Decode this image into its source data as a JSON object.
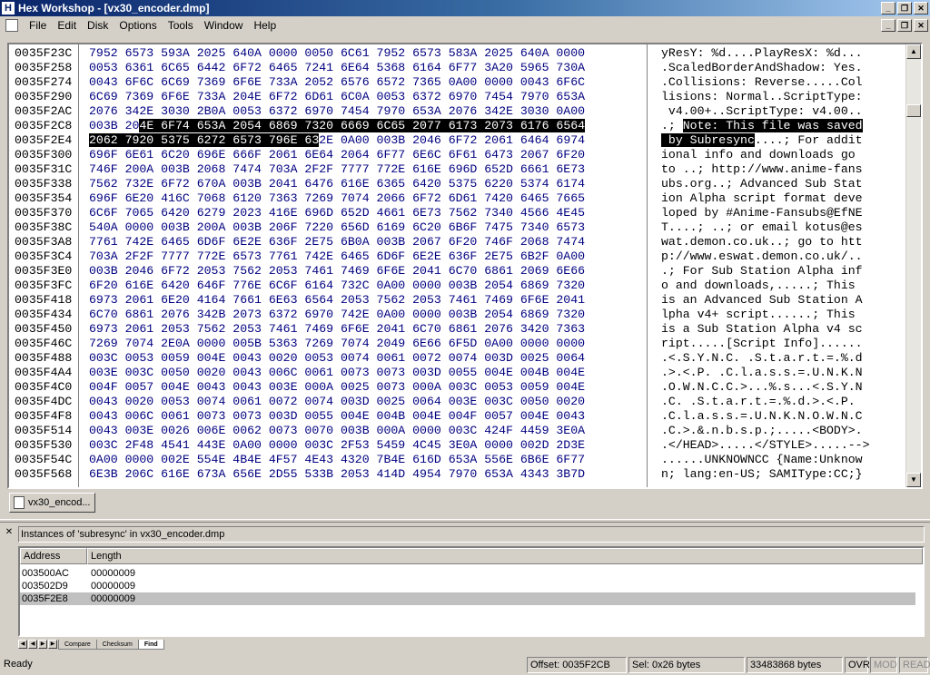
{
  "window": {
    "app_icon_glyph": "H",
    "title": "Hex Workshop - [vx30_encoder.dmp]",
    "buttons": [
      "_",
      "❐",
      "✕"
    ]
  },
  "menu": {
    "items": [
      "File",
      "Edit",
      "Disk",
      "Options",
      "Tools",
      "Window",
      "Help"
    ],
    "mdi_buttons": [
      "_",
      "❐",
      "✕"
    ]
  },
  "hex_rows": [
    {
      "addr": "0035F23C",
      "hex": "7952 6573 593A 2025 640A 0000 0050 6C61 7952 6573 583A 2025 640A 0000",
      "ascii": "yResY: %d....PlayResX: %d..."
    },
    {
      "addr": "0035F258",
      "hex": "0053 6361 6C65 6442 6F72 6465 7241 6E64 5368 6164 6F77 3A20 5965 730A",
      "ascii": ".ScaledBorderAndShadow: Yes."
    },
    {
      "addr": "0035F274",
      "hex": "0043 6F6C 6C69 7369 6F6E 733A 2052 6576 6572 7365 0A00 0000 0043 6F6C",
      "ascii": ".Collisions: Reverse.....Col"
    },
    {
      "addr": "0035F290",
      "hex": "6C69 7369 6F6E 733A 204E 6F72 6D61 6C0A 0053 6372 6970 7454 7970 653A",
      "ascii": "lisions: Normal..ScriptType:"
    },
    {
      "addr": "0035F2AC",
      "hex": "2076 342E 3030 2B0A 0053 6372 6970 7454 7970 653A 2076 342E 3030 0A00",
      "ascii": " v4.00+..ScriptType: v4.00.."
    },
    {
      "addr": "0035F2C8",
      "hex_pre": "003B 20",
      "hex_sel": "4E 6F74 653A 2054 6869 7320 6669 6C65 2077 6173 2073 6176 6564",
      "hex_post": "",
      "ascii_pre": ".; ",
      "ascii_sel": "Note: This file was saved",
      "ascii_post": ""
    },
    {
      "addr": "0035F2E4",
      "hex_pre": "",
      "hex_sel": "2062 7920 5375 6272 6573 796E 63",
      "hex_post": "2E 0A00 003B 2046 6F72 2061 6464 6974",
      "ascii_pre": "",
      "ascii_sel": " by Subresync",
      "ascii_post": "....; For addit"
    },
    {
      "addr": "0035F300",
      "hex": "696F 6E61 6C20 696E 666F 2061 6E64 2064 6F77 6E6C 6F61 6473 2067 6F20",
      "ascii": "ional info and downloads go "
    },
    {
      "addr": "0035F31C",
      "hex": "746F 200A 003B 2068 7474 703A 2F2F 7777 772E 616E 696D 652D 6661 6E73",
      "ascii": "to ..; http://www.anime-fans"
    },
    {
      "addr": "0035F338",
      "hex": "7562 732E 6F72 670A 003B 2041 6476 616E 6365 6420 5375 6220 5374 6174",
      "ascii": "ubs.org..; Advanced Sub Stat"
    },
    {
      "addr": "0035F354",
      "hex": "696F 6E20 416C 7068 6120 7363 7269 7074 2066 6F72 6D61 7420 6465 7665",
      "ascii": "ion Alpha script format deve"
    },
    {
      "addr": "0035F370",
      "hex": "6C6F 7065 6420 6279 2023 416E 696D 652D 4661 6E73 7562 7340 4566 4E45",
      "ascii": "loped by #Anime-Fansubs@EfNE"
    },
    {
      "addr": "0035F38C",
      "hex": "540A 0000 003B 200A 003B 206F 7220 656D 6169 6C20 6B6F 7475 7340 6573",
      "ascii": "T....; ..; or email kotus@es"
    },
    {
      "addr": "0035F3A8",
      "hex": "7761 742E 6465 6D6F 6E2E 636F 2E75 6B0A 003B 2067 6F20 746F 2068 7474",
      "ascii": "wat.demon.co.uk..; go to htt"
    },
    {
      "addr": "0035F3C4",
      "hex": "703A 2F2F 7777 772E 6573 7761 742E 6465 6D6F 6E2E 636F 2E75 6B2F 0A00",
      "ascii": "p://www.eswat.demon.co.uk/.."
    },
    {
      "addr": "0035F3E0",
      "hex": "003B 2046 6F72 2053 7562 2053 7461 7469 6F6E 2041 6C70 6861 2069 6E66",
      "ascii": ".; For Sub Station Alpha inf"
    },
    {
      "addr": "0035F3FC",
      "hex": "6F20 616E 6420 646F 776E 6C6F 6164 732C 0A00 0000 003B 2054 6869 7320",
      "ascii": "o and downloads,.....; This "
    },
    {
      "addr": "0035F418",
      "hex": "6973 2061 6E20 4164 7661 6E63 6564 2053 7562 2053 7461 7469 6F6E 2041",
      "ascii": "is an Advanced Sub Station A"
    },
    {
      "addr": "0035F434",
      "hex": "6C70 6861 2076 342B 2073 6372 6970 742E 0A00 0000 003B 2054 6869 7320",
      "ascii": "lpha v4+ script......; This "
    },
    {
      "addr": "0035F450",
      "hex": "6973 2061 2053 7562 2053 7461 7469 6F6E 2041 6C70 6861 2076 3420 7363",
      "ascii": "is a Sub Station Alpha v4 sc"
    },
    {
      "addr": "0035F46C",
      "hex": "7269 7074 2E0A 0000 005B 5363 7269 7074 2049 6E66 6F5D 0A00 0000 0000",
      "ascii": "ript.....[Script Info]......"
    },
    {
      "addr": "0035F488",
      "hex": "003C 0053 0059 004E 0043 0020 0053 0074 0061 0072 0074 003D 0025 0064",
      "ascii": ".<.S.Y.N.C. .S.t.a.r.t.=.%.d"
    },
    {
      "addr": "0035F4A4",
      "hex": "003E 003C 0050 0020 0043 006C 0061 0073 0073 003D 0055 004E 004B 004E",
      "ascii": ".>.<.P. .C.l.a.s.s.=.U.N.K.N"
    },
    {
      "addr": "0035F4C0",
      "hex": "004F 0057 004E 0043 0043 003E 000A 0025 0073 000A 003C 0053 0059 004E",
      "ascii": ".O.W.N.C.C.>...%.s...<.S.Y.N"
    },
    {
      "addr": "0035F4DC",
      "hex": "0043 0020 0053 0074 0061 0072 0074 003D 0025 0064 003E 003C 0050 0020",
      "ascii": ".C. .S.t.a.r.t.=.%.d.>.<.P. "
    },
    {
      "addr": "0035F4F8",
      "hex": "0043 006C 0061 0073 0073 003D 0055 004E 004B 004E 004F 0057 004E 0043",
      "ascii": ".C.l.a.s.s.=.U.N.K.N.O.W.N.C"
    },
    {
      "addr": "0035F514",
      "hex": "0043 003E 0026 006E 0062 0073 0070 003B 000A 0000 003C 424F 4459 3E0A",
      "ascii": ".C.>.&.n.b.s.p.;.....<BODY>."
    },
    {
      "addr": "0035F530",
      "hex": "003C 2F48 4541 443E 0A00 0000 003C 2F53 5459 4C45 3E0A 0000 002D 2D3E",
      "ascii": ".</HEAD>.....</STYLE>.....-->"
    },
    {
      "addr": "0035F54C",
      "hex": "0A00 0000 002E 554E 4B4E 4F57 4E43 4320 7B4E 616D 653A 556E 6B6E 6F77",
      "ascii": "......UNKNOWNCC {Name:Unknow"
    },
    {
      "addr": "0035F568",
      "hex": "6E3B 206C 616E 673A 656E 2D55 533B 2053 414D 4954 7970 653A 4343 3B7D",
      "ascii": "n; lang:en-US; SAMIType:CC;}"
    }
  ],
  "doc_tab": {
    "label": "vx30_encod..."
  },
  "results": {
    "title": "Instances of 'subresync' in vx30_encoder.dmp",
    "columns": [
      "Address",
      "Length"
    ],
    "rows": [
      {
        "address": "003500AC",
        "length": "00000009"
      },
      {
        "address": "003502D9",
        "length": "00000009"
      },
      {
        "address": "0035F2E8",
        "length": "00000009"
      }
    ],
    "tabs": [
      "Compare",
      "Checksum",
      "Find"
    ],
    "active_tab": "Find"
  },
  "status": {
    "ready": "Ready",
    "offset": "Offset: 0035F2CB",
    "selection": "Sel: 0x26 bytes",
    "size": "33483868 bytes",
    "ovr": "OVR",
    "mod": "MOD",
    "read": "READ"
  }
}
